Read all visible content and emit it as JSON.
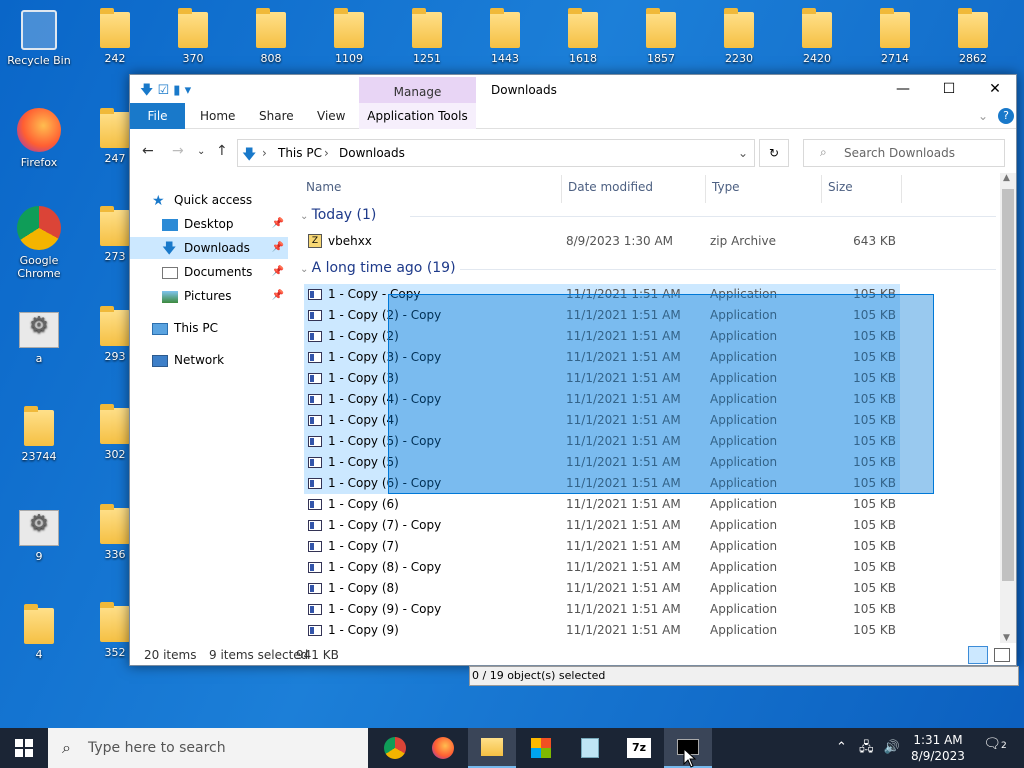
{
  "desktop": {
    "row1": [
      "Recycle Bin",
      "242",
      "370",
      "808",
      "1109",
      "1251",
      "1443",
      "1618",
      "1857",
      "2230",
      "2420",
      "2714",
      "2862"
    ],
    "col0": [
      "Firefox",
      "Google Chrome",
      "a",
      "23744",
      "9",
      "4"
    ],
    "col1": [
      "247",
      "273",
      "293",
      "302",
      "336",
      "352"
    ]
  },
  "window": {
    "manage_tab": "Manage",
    "title": "Downloads",
    "tabs": {
      "file": "File",
      "home": "Home",
      "share": "Share",
      "view": "View",
      "app_tools": "Application Tools"
    },
    "breadcrumb": [
      "This PC",
      "Downloads"
    ],
    "search_placeholder": "Search Downloads",
    "nav": {
      "quick_access": "Quick access",
      "desktop": "Desktop",
      "downloads": "Downloads",
      "documents": "Documents",
      "pictures": "Pictures",
      "this_pc": "This PC",
      "network": "Network"
    },
    "columns": {
      "name": "Name",
      "date": "Date modified",
      "type": "Type",
      "size": "Size"
    },
    "groups": {
      "today": "Today (1)",
      "old": "A long time ago (19)"
    },
    "today_file": {
      "name": "vbehxx",
      "date": "8/9/2023 1:30 AM",
      "type": "zip Archive",
      "size": "643 KB"
    },
    "files": [
      {
        "name": "1 - Copy - Copy",
        "date": "11/1/2021 1:51 AM",
        "type": "Application",
        "size": "105 KB"
      },
      {
        "name": "1 - Copy (2) - Copy",
        "date": "11/1/2021 1:51 AM",
        "type": "Application",
        "size": "105 KB"
      },
      {
        "name": "1 - Copy (2)",
        "date": "11/1/2021 1:51 AM",
        "type": "Application",
        "size": "105 KB"
      },
      {
        "name": "1 - Copy (3) - Copy",
        "date": "11/1/2021 1:51 AM",
        "type": "Application",
        "size": "105 KB"
      },
      {
        "name": "1 - Copy (3)",
        "date": "11/1/2021 1:51 AM",
        "type": "Application",
        "size": "105 KB"
      },
      {
        "name": "1 - Copy (4) - Copy",
        "date": "11/1/2021 1:51 AM",
        "type": "Application",
        "size": "105 KB"
      },
      {
        "name": "1 - Copy (4)",
        "date": "11/1/2021 1:51 AM",
        "type": "Application",
        "size": "105 KB"
      },
      {
        "name": "1 - Copy (5) - Copy",
        "date": "11/1/2021 1:51 AM",
        "type": "Application",
        "size": "105 KB"
      },
      {
        "name": "1 - Copy (5)",
        "date": "11/1/2021 1:51 AM",
        "type": "Application",
        "size": "105 KB"
      },
      {
        "name": "1 - Copy (6) - Copy",
        "date": "11/1/2021 1:51 AM",
        "type": "Application",
        "size": "105 KB"
      },
      {
        "name": "1 - Copy (6)",
        "date": "11/1/2021 1:51 AM",
        "type": "Application",
        "size": "105 KB"
      },
      {
        "name": "1 - Copy (7) - Copy",
        "date": "11/1/2021 1:51 AM",
        "type": "Application",
        "size": "105 KB"
      },
      {
        "name": "1 - Copy (7)",
        "date": "11/1/2021 1:51 AM",
        "type": "Application",
        "size": "105 KB"
      },
      {
        "name": "1 - Copy (8) - Copy",
        "date": "11/1/2021 1:51 AM",
        "type": "Application",
        "size": "105 KB"
      },
      {
        "name": "1 - Copy (8)",
        "date": "11/1/2021 1:51 AM",
        "type": "Application",
        "size": "105 KB"
      },
      {
        "name": "1 - Copy (9) - Copy",
        "date": "11/1/2021 1:51 AM",
        "type": "Application",
        "size": "105 KB"
      },
      {
        "name": "1 - Copy (9)",
        "date": "11/1/2021 1:51 AM",
        "type": "Application",
        "size": "105 KB"
      }
    ],
    "selected_count": 10,
    "status": {
      "items": "20 items",
      "selected": "9 items selected",
      "size": "941 KB"
    }
  },
  "sevenzip_status": "0 / 19 object(s) selected",
  "taskbar": {
    "search_placeholder": "Type here to search",
    "time": "1:31 AM",
    "date": "8/9/2023",
    "notifications": "2",
    "apps": [
      "chrome-icon",
      "firefox-icon",
      "file-explorer-icon",
      "store-icon",
      "notepad-icon",
      "7zip-icon",
      "terminal-icon"
    ]
  }
}
